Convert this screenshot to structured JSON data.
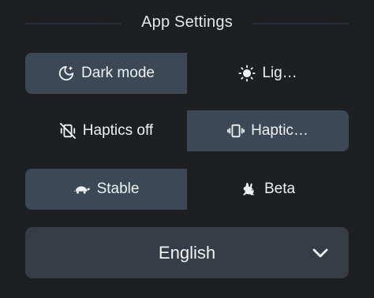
{
  "header": {
    "title": "App Settings"
  },
  "theme": {
    "options": [
      {
        "label": "Dark mode",
        "icon": "moon-icon",
        "selected": true
      },
      {
        "label": "Lig…",
        "icon": "sun-icon",
        "selected": false
      }
    ]
  },
  "haptics": {
    "options": [
      {
        "label": "Haptics off",
        "icon": "vibration-off-icon",
        "selected": false
      },
      {
        "label": "Haptic…",
        "icon": "vibration-icon",
        "selected": true
      }
    ]
  },
  "channel": {
    "options": [
      {
        "label": "Stable",
        "icon": "turtle-icon",
        "selected": true
      },
      {
        "label": "Beta",
        "icon": "rabbit-icon",
        "selected": false
      }
    ]
  },
  "language": {
    "selected": "English",
    "icon": "chevron-down-icon"
  },
  "colors": {
    "background": "#1d1f22",
    "segment_active": "#3d4856",
    "dropdown_bg": "#353c46",
    "divider": "#243039",
    "text": "#eef0f2"
  }
}
